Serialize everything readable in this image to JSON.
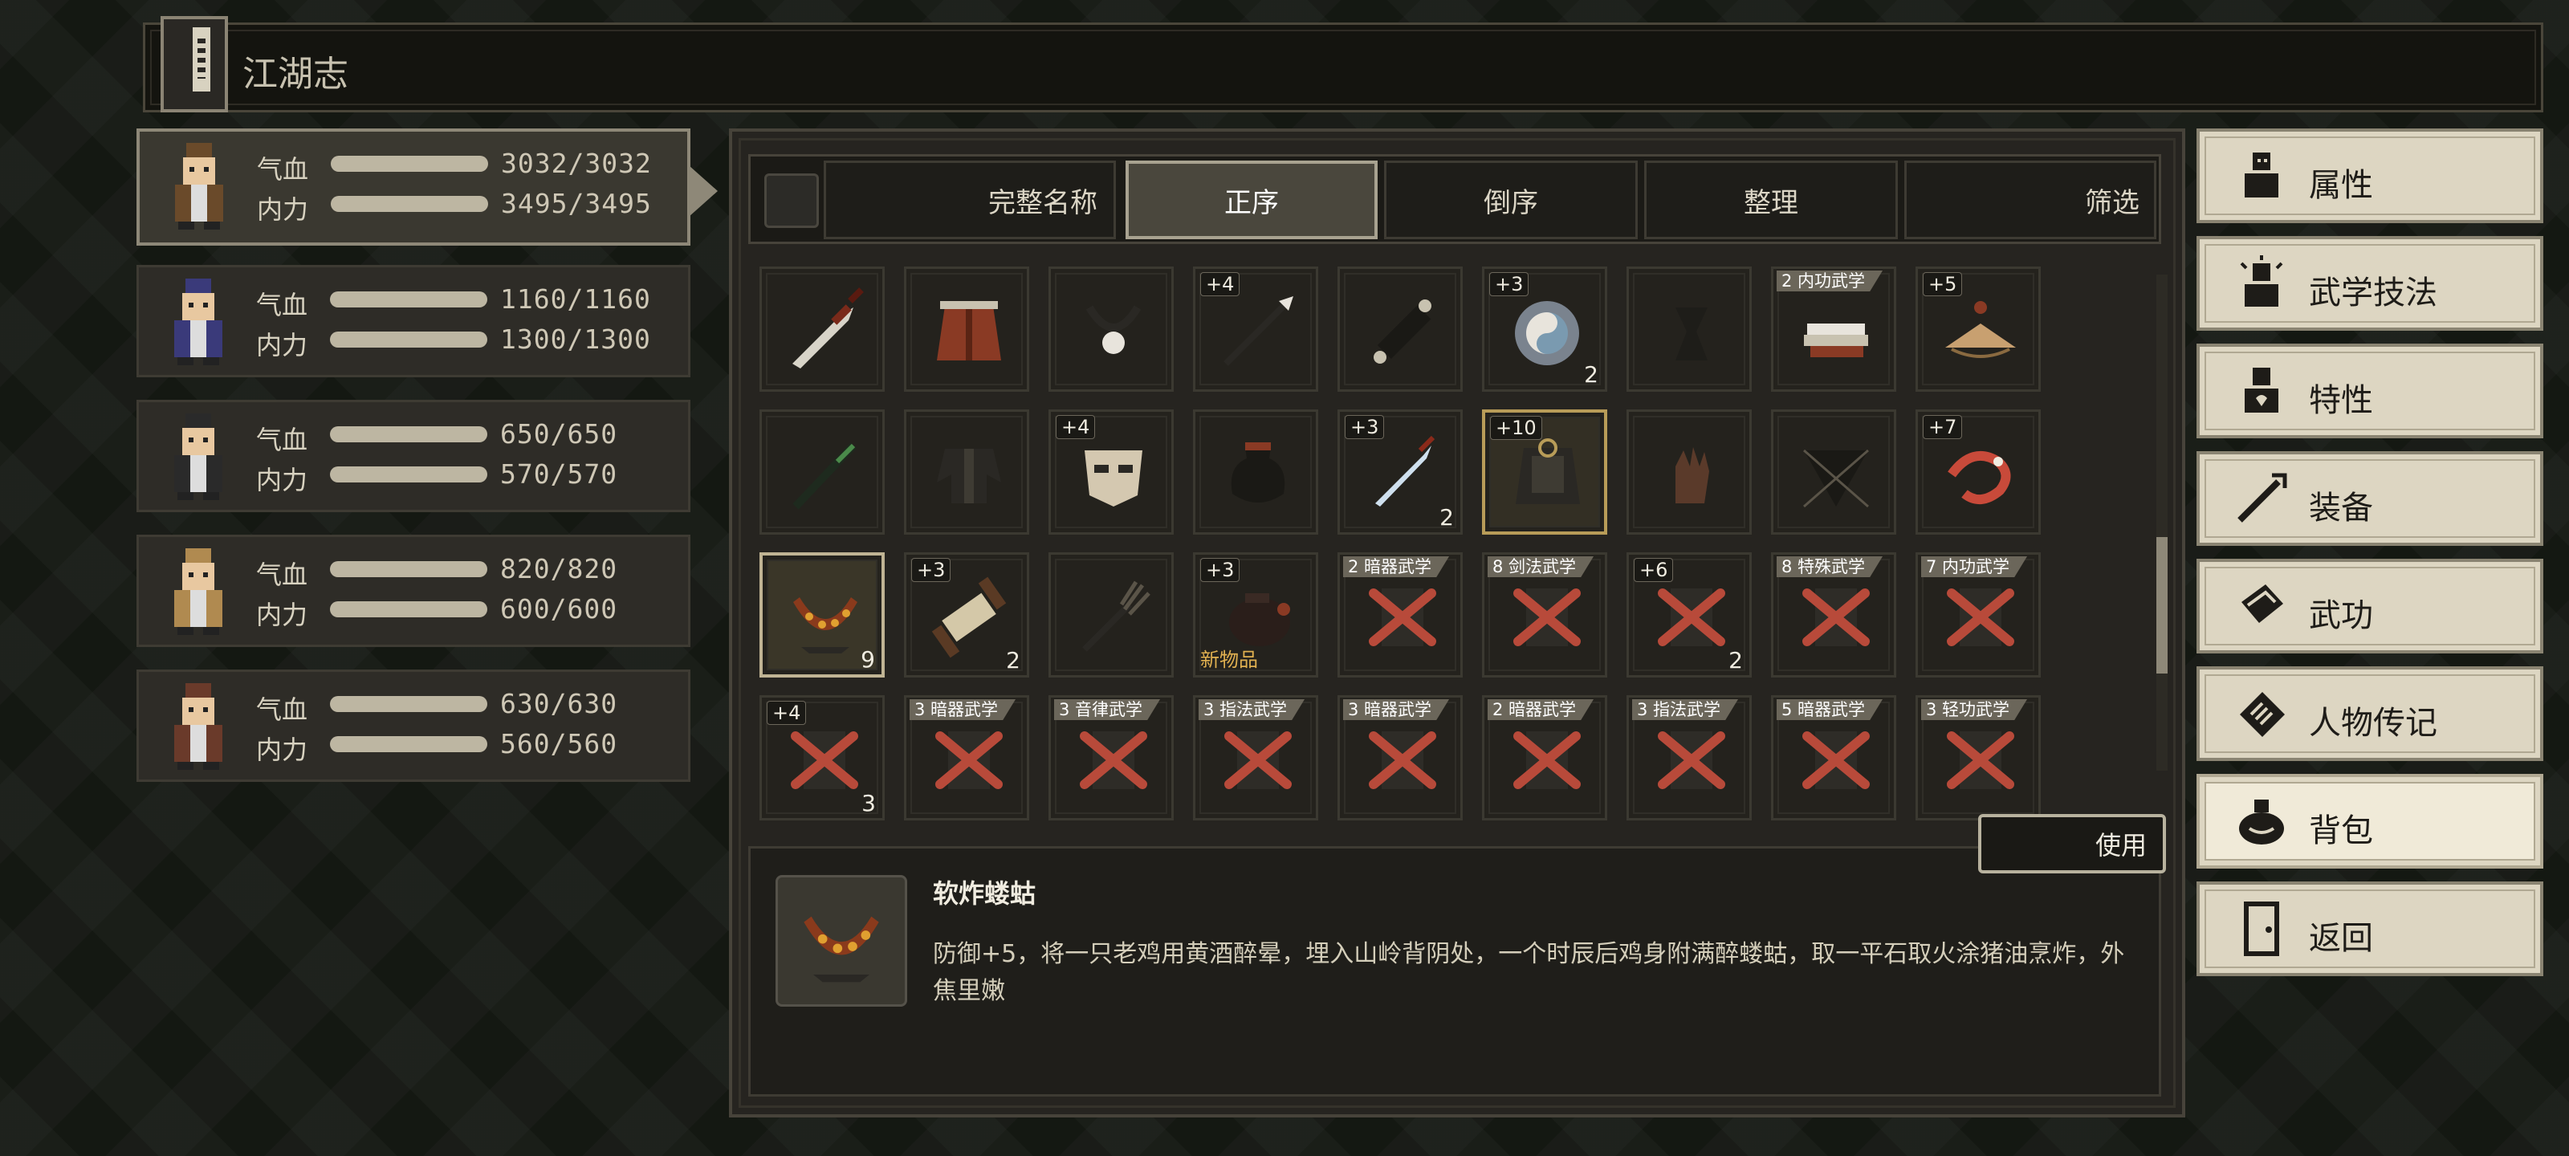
{
  "page_title": "江湖志",
  "characters": [
    {
      "hp_label": "气血",
      "mp_label": "内力",
      "hp": "3032/3032",
      "mp": "3495/3495",
      "hp_frac": 1.0,
      "mp_frac": 1.0,
      "active": true
    },
    {
      "hp_label": "气血",
      "mp_label": "内力",
      "hp": "1160/1160",
      "mp": "1300/1300",
      "hp_frac": 1.0,
      "mp_frac": 1.0,
      "active": false
    },
    {
      "hp_label": "气血",
      "mp_label": "内力",
      "hp": "650/650",
      "mp": "570/570",
      "hp_frac": 1.0,
      "mp_frac": 1.0,
      "active": false
    },
    {
      "hp_label": "气血",
      "mp_label": "内力",
      "hp": "820/820",
      "mp": "600/600",
      "hp_frac": 1.0,
      "mp_frac": 1.0,
      "active": false
    },
    {
      "hp_label": "气血",
      "mp_label": "内力",
      "hp": "630/630",
      "mp": "560/560",
      "hp_frac": 1.0,
      "mp_frac": 1.0,
      "active": false
    }
  ],
  "toolbar": {
    "full_name": "完整名称",
    "ascending": "正序",
    "descending": "倒序",
    "arrange": "整理",
    "filter": "筛选"
  },
  "inventory_rows": [
    [
      {
        "icon": "broadsword-icon"
      },
      {
        "icon": "leather-armor-icon"
      },
      {
        "icon": "pearl-necklace-icon"
      },
      {
        "icon": "spear-icon",
        "enh": "+4"
      },
      {
        "icon": "black-scroll-icon"
      },
      {
        "icon": "jade-pendant-icon",
        "enh": "+3",
        "count": "2"
      },
      {
        "icon": "shadow-vase-icon"
      },
      {
        "icon": "book-stack-icon",
        "tag": "2 内功武学"
      },
      {
        "icon": "bamboo-hat-icon",
        "enh": "+5"
      }
    ],
    [
      {
        "icon": "green-stick-icon"
      },
      {
        "icon": "black-robe-icon"
      },
      {
        "icon": "mask-icon",
        "enh": "+4"
      },
      {
        "icon": "wine-jar-icon"
      },
      {
        "icon": "dagger-icon",
        "enh": "+3",
        "count": "2"
      },
      {
        "icon": "dark-armor-icon",
        "enh": "+10",
        "highlight": true
      },
      {
        "icon": "glove-icon"
      },
      {
        "icon": "net-icon"
      },
      {
        "icon": "dragon-icon",
        "enh": "+7"
      }
    ],
    [
      {
        "icon": "fried-chicken-icon",
        "count": "9",
        "selected": true
      },
      {
        "icon": "scroll-icon",
        "enh": "+3",
        "count": "2"
      },
      {
        "icon": "fork-icon"
      },
      {
        "icon": "pot-icon",
        "enh": "+3",
        "new": "新物品"
      },
      {
        "icon": "locked-manual-icon",
        "tag": "2 暗器武学"
      },
      {
        "icon": "locked-manual-icon",
        "tag": "8 剑法武学"
      },
      {
        "icon": "locked-manual-icon",
        "enh": "+6",
        "count": "2"
      },
      {
        "icon": "locked-manual-icon",
        "tag": "8 特殊武学"
      },
      {
        "icon": "locked-manual-icon",
        "tag": "7 内功武学"
      }
    ],
    [
      {
        "icon": "locked-manual-icon",
        "enh": "+4",
        "count": "3"
      },
      {
        "icon": "locked-manual-icon",
        "tag": "3 暗器武学"
      },
      {
        "icon": "locked-manual-icon",
        "tag": "3 音律武学"
      },
      {
        "icon": "locked-manual-icon",
        "tag": "3 指法武学"
      },
      {
        "icon": "locked-manual-icon",
        "tag": "3 暗器武学"
      },
      {
        "icon": "locked-manual-icon",
        "tag": "2 暗器武学"
      },
      {
        "icon": "locked-manual-icon",
        "tag": "3 指法武学"
      },
      {
        "icon": "locked-manual-icon",
        "tag": "5 暗器武学"
      },
      {
        "icon": "locked-manual-icon",
        "tag": "3 轻功武学"
      }
    ]
  ],
  "scroll_position": 0.73,
  "selected_item": {
    "name": "软炸蝼蛄",
    "description": "防御+5，将一只老鸡用黄酒醉晕，埋入山岭背阴处，一个时辰后鸡身附满醉蝼蛄，取一平石取火涂猪油烹炸，外焦里嫩",
    "icon": "fried-chicken-icon"
  },
  "use_button": "使用",
  "menu": [
    {
      "label": "属性",
      "icon": "person-icon"
    },
    {
      "label": "武学技法",
      "icon": "person-aura-icon"
    },
    {
      "label": "特性",
      "icon": "person-heart-icon"
    },
    {
      "label": "装备",
      "icon": "sword-icon"
    },
    {
      "label": "武功",
      "icon": "manual-book-icon"
    },
    {
      "label": "人物传记",
      "icon": "biography-icon"
    },
    {
      "label": "背包",
      "icon": "bag-icon",
      "active": true
    },
    {
      "label": "返回",
      "icon": "door-icon"
    }
  ]
}
